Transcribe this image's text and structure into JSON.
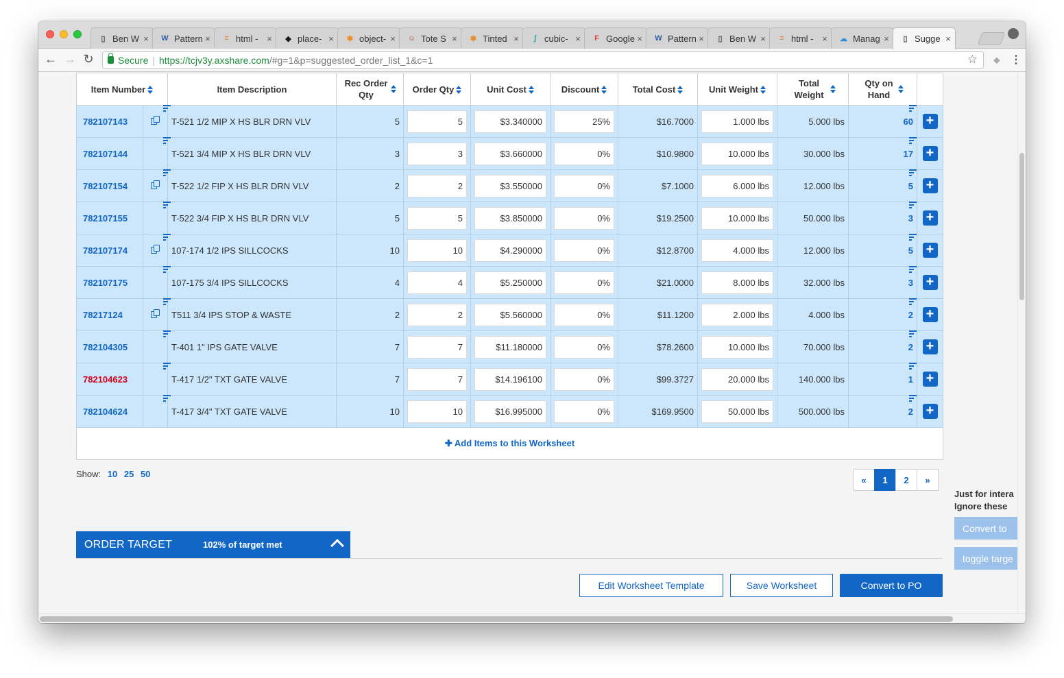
{
  "browser": {
    "tabs": [
      {
        "title": "Ben W",
        "icon": "doc-icon"
      },
      {
        "title": "Pattern",
        "icon": "wp-icon"
      },
      {
        "title": "html -",
        "icon": "so-icon"
      },
      {
        "title": "place-",
        "icon": "ext-icon"
      },
      {
        "title": "object-",
        "icon": "asterisk-icon"
      },
      {
        "title": "Tote S",
        "icon": "face-icon"
      },
      {
        "title": "Tinted",
        "icon": "asterisk-icon"
      },
      {
        "title": "cubic-",
        "icon": "curve-icon"
      },
      {
        "title": "Google",
        "icon": "f-icon"
      },
      {
        "title": "Pattern",
        "icon": "wp-icon"
      },
      {
        "title": "Ben W",
        "icon": "doc-icon"
      },
      {
        "title": "html -",
        "icon": "so-icon"
      },
      {
        "title": "Manag",
        "icon": "cloud-icon"
      },
      {
        "title": "Sugge",
        "icon": "doc-icon"
      }
    ],
    "active_tab": 13,
    "address": {
      "secure_label": "Secure",
      "url_host": "https://tcjv3y.axshare.com",
      "url_path": "/#g=1&p=suggested_order_list_1&c=1"
    }
  },
  "table": {
    "headers": {
      "item_number": "Item Number",
      "description": "Item Description",
      "rec_qty": "Rec Order Qty",
      "order_qty": "Order Qty",
      "unit_cost": "Unit Cost",
      "discount": "Discount",
      "total_cost": "Total Cost",
      "unit_weight": "Unit Weight",
      "total_weight": "Total Weight",
      "qty_on_hand": "Qty on Hand"
    },
    "rows": [
      {
        "item": "782107143",
        "copy": true,
        "red": false,
        "description": "T-521 1/2 MIP X HS BLR DRN VLV",
        "rec_qty": "5",
        "order_qty": "5",
        "unit_cost": "$3.340000",
        "discount": "25%",
        "total_cost": "$16.7000",
        "unit_weight": "1.000 lbs",
        "total_weight": "5.000 lbs",
        "qoh": "60"
      },
      {
        "item": "782107144",
        "copy": false,
        "red": false,
        "description": "T-521 3/4 MIP X HS BLR DRN VLV",
        "rec_qty": "3",
        "order_qty": "3",
        "unit_cost": "$3.660000",
        "discount": "0%",
        "total_cost": "$10.9800",
        "unit_weight": "10.000 lbs",
        "total_weight": "30.000 lbs",
        "qoh": "17"
      },
      {
        "item": "782107154",
        "copy": true,
        "red": false,
        "description": "T-522 1/2 FIP X HS BLR DRN VLV",
        "rec_qty": "2",
        "order_qty": "2",
        "unit_cost": "$3.550000",
        "discount": "0%",
        "total_cost": "$7.1000",
        "unit_weight": "6.000 lbs",
        "total_weight": "12.000 lbs",
        "qoh": "5"
      },
      {
        "item": "782107155",
        "copy": false,
        "red": false,
        "description": "T-522 3/4 FIP X HS BLR DRN VLV",
        "rec_qty": "5",
        "order_qty": "5",
        "unit_cost": "$3.850000",
        "discount": "0%",
        "total_cost": "$19.2500",
        "unit_weight": "10.000 lbs",
        "total_weight": "50.000 lbs",
        "qoh": "3"
      },
      {
        "item": "782107174",
        "copy": true,
        "red": false,
        "description": "107-174 1/2 IPS SILLCOCKS",
        "rec_qty": "10",
        "order_qty": "10",
        "unit_cost": "$4.290000",
        "discount": "0%",
        "total_cost": "$12.8700",
        "unit_weight": "4.000 lbs",
        "total_weight": "12.000 lbs",
        "qoh": "5"
      },
      {
        "item": "782107175",
        "copy": false,
        "red": false,
        "description": "107-175 3/4 IPS SILLCOCKS",
        "rec_qty": "4",
        "order_qty": "4",
        "unit_cost": "$5.250000",
        "discount": "0%",
        "total_cost": "$21.0000",
        "unit_weight": "8.000 lbs",
        "total_weight": "32.000 lbs",
        "qoh": "3"
      },
      {
        "item": "78217124",
        "copy": true,
        "red": false,
        "description": "T511 3/4 IPS STOP & WASTE",
        "rec_qty": "2",
        "order_qty": "2",
        "unit_cost": "$5.560000",
        "discount": "0%",
        "total_cost": "$11.1200",
        "unit_weight": "2.000 lbs",
        "total_weight": "4.000 lbs",
        "qoh": "2"
      },
      {
        "item": "782104305",
        "copy": false,
        "red": false,
        "description": "T-401 1\" IPS GATE VALVE",
        "rec_qty": "7",
        "order_qty": "7",
        "unit_cost": "$11.180000",
        "discount": "0%",
        "total_cost": "$78.2600",
        "unit_weight": "10.000 lbs",
        "total_weight": "70.000 lbs",
        "qoh": "2"
      },
      {
        "item": "782104623",
        "copy": false,
        "red": true,
        "description": "T-417 1/2\" TXT GATE VALVE",
        "rec_qty": "7",
        "order_qty": "7",
        "unit_cost": "$14.196100",
        "discount": "0%",
        "total_cost": "$99.3727",
        "unit_weight": "20.000 lbs",
        "total_weight": "140.000 lbs",
        "qoh": "1"
      },
      {
        "item": "782104624",
        "copy": false,
        "red": false,
        "description": "T-417 3/4\" TXT GATE VALVE",
        "rec_qty": "10",
        "order_qty": "10",
        "unit_cost": "$16.995000",
        "discount": "0%",
        "total_cost": "$169.9500",
        "unit_weight": "50.000 lbs",
        "total_weight": "500.000 lbs",
        "qoh": "2"
      }
    ],
    "add_items_label": "Add Items to this Worksheet"
  },
  "pagination": {
    "show_label": "Show:",
    "show_options": [
      "10",
      "25",
      "50"
    ],
    "prev": "«",
    "pages": [
      "1",
      "2"
    ],
    "current_page": "1",
    "next": "»"
  },
  "side_panel": {
    "line1": "Just for intera",
    "line2": "Ignore these",
    "button1": "Convert to",
    "button2": "toggle targe"
  },
  "order_target": {
    "title": "ORDER TARGET",
    "percent_text": "102% of target met"
  },
  "actions": {
    "edit_template": "Edit Worksheet Template",
    "save": "Save Worksheet",
    "convert": "Convert to PO"
  },
  "colors": {
    "accent": "#1166c6",
    "row_bg": "#cce6fb",
    "alert_red": "#d0021b"
  }
}
